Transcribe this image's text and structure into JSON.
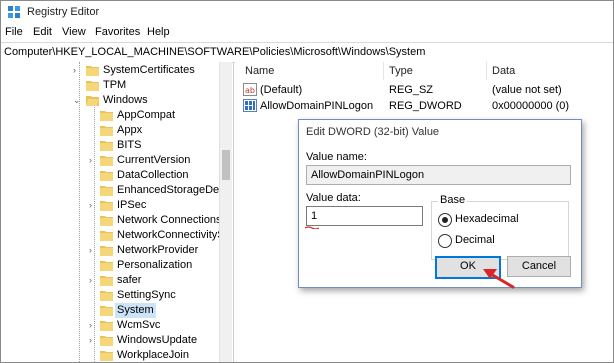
{
  "window": {
    "title": "Registry Editor"
  },
  "menu": [
    "File",
    "Edit",
    "View",
    "Favorites",
    "Help"
  ],
  "address": "Computer\\HKEY_LOCAL_MACHINE\\SOFTWARE\\Policies\\Microsoft\\Windows\\System",
  "tree": {
    "items": [
      "SystemCertificates",
      "TPM",
      "Windows",
      "AppCompat",
      "Appx",
      "BITS",
      "CurrentVersion",
      "DataCollection",
      "EnhancedStorageDevic",
      "IPSec",
      "Network Connections",
      "NetworkConnectivityS",
      "NetworkProvider",
      "Personalization",
      "safer",
      "SettingSync",
      "System",
      "WcmSvc",
      "WindowsUpdate",
      "WorkplaceJoin"
    ],
    "selected": "System"
  },
  "list": {
    "headers": {
      "name": "Name",
      "type": "Type",
      "data": "Data"
    },
    "rows": [
      {
        "name": "(Default)",
        "type": "REG_SZ",
        "data": "(value not set)",
        "icon": "string-value-icon"
      },
      {
        "name": "AllowDomainPINLogon",
        "type": "REG_DWORD",
        "data": "0x00000000 (0)",
        "icon": "binary-value-icon"
      }
    ]
  },
  "dialog": {
    "title": "Edit DWORD (32-bit) Value",
    "value_name_label": "Value name:",
    "value_name": "AllowDomainPINLogon",
    "value_data_label": "Value data:",
    "value_data": "1",
    "base_label": "Base",
    "radio_hex": "Hexadecimal",
    "radio_dec": "Decimal",
    "selected_base": "Hexadecimal",
    "ok": "OK",
    "cancel": "Cancel"
  },
  "colors": {
    "selection": "#cce4f7",
    "folder": "#e8c25a",
    "annotation": "#d9262b",
    "default_button_border": "#0078d7"
  }
}
